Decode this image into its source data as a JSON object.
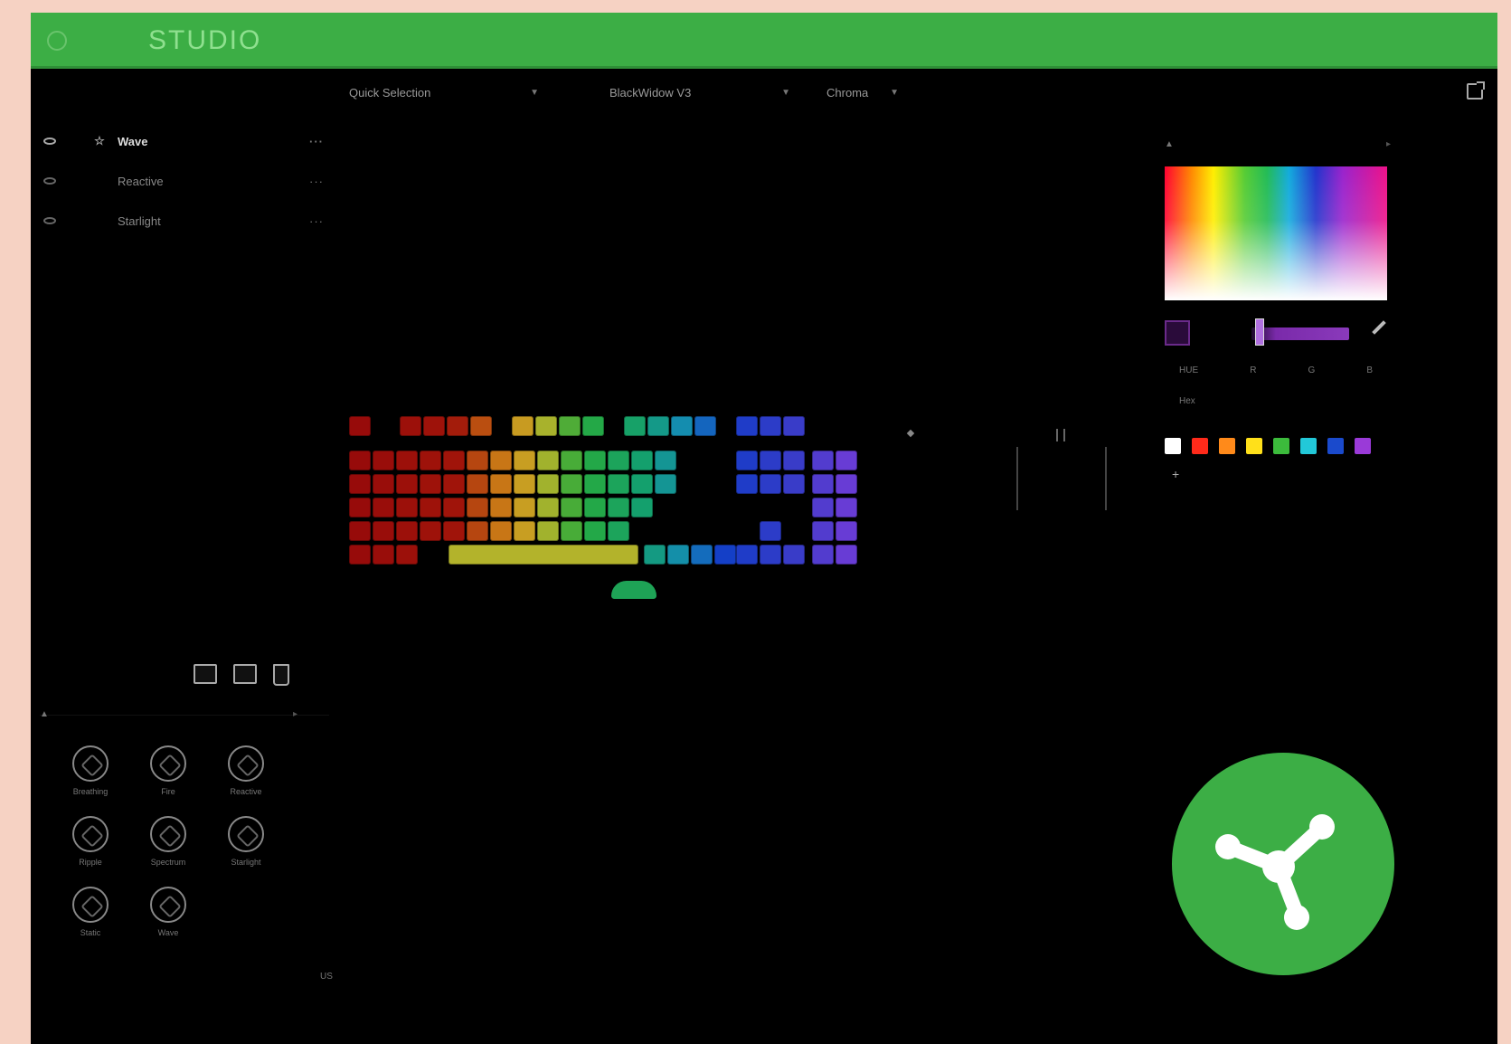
{
  "app": {
    "title": "STUDIO",
    "subtitle": "",
    "brand_color": "#3cae45"
  },
  "toolbar": {
    "quick_selection_label": "Quick Selection",
    "device_label": "BlackWidow V3",
    "third_dropdown_label": "Chroma",
    "export_icon": "external-window-icon"
  },
  "layers": [
    {
      "name": "Wave",
      "icon": "star-icon",
      "active": true
    },
    {
      "name": "Reactive",
      "icon": "",
      "active": false
    },
    {
      "name": "Starlight",
      "icon": "",
      "active": false
    }
  ],
  "layer_more_label": "···",
  "effects": [
    {
      "label": "Breathing",
      "icon": "breathing-icon"
    },
    {
      "label": "Fire",
      "icon": "fire-icon"
    },
    {
      "label": "Reactive",
      "icon": "reactive-icon"
    },
    {
      "label": "Ripple",
      "icon": "ripple-icon"
    },
    {
      "label": "Spectrum",
      "icon": "spectrum-icon"
    },
    {
      "label": "Starlight",
      "icon": "starlight-icon"
    },
    {
      "label": "Static",
      "icon": "static-icon"
    },
    {
      "label": "Wave",
      "icon": "wave-icon"
    }
  ],
  "footer": {
    "text": "US"
  },
  "color_panel": {
    "row1_labels": [
      "HUE",
      "R",
      "G",
      "B"
    ],
    "row2_labels": [
      "Hex",
      "",
      "",
      ""
    ],
    "presets": [
      "#ffffff",
      "#ff2a1a",
      "#ff8a1a",
      "#ffe01a",
      "#3cbb3c",
      "#22c8d8",
      "#1a4acc",
      "#9a3ad8"
    ],
    "add_label": "+",
    "current_color": "#2a0b3a"
  },
  "fab": {
    "icon": "share-icon"
  }
}
